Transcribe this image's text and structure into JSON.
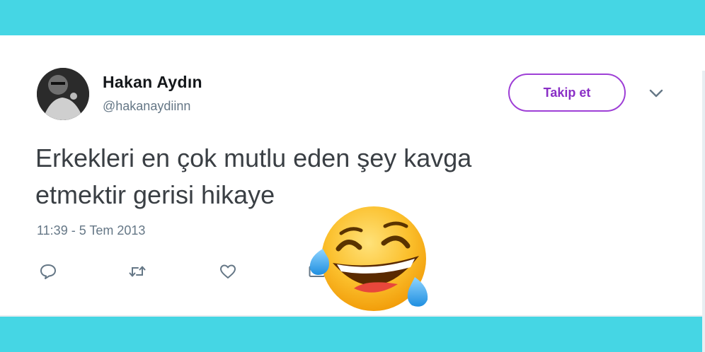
{
  "user": {
    "name": "Hakan Aydın",
    "handle": "@hakanaydiinn"
  },
  "follow_button": {
    "label": "Takip et"
  },
  "tweet": {
    "line1": "Erkekleri en çok mutlu eden şey kavga",
    "line2": "etmektir gerisi hikaye",
    "timestamp": "11:39 - 5 Tem 2013"
  },
  "icons": {
    "reply": "reply-icon",
    "retweet": "retweet-icon",
    "like": "heart-icon",
    "message": "envelope-icon",
    "more": "chevron-down-icon",
    "emoji": "tears-of-joy-emoji"
  },
  "colors": {
    "background": "#45d6e4",
    "card": "#ffffff",
    "follow_accent": "#9e3fd6",
    "text_primary": "#14171a",
    "text_secondary": "#657786"
  }
}
